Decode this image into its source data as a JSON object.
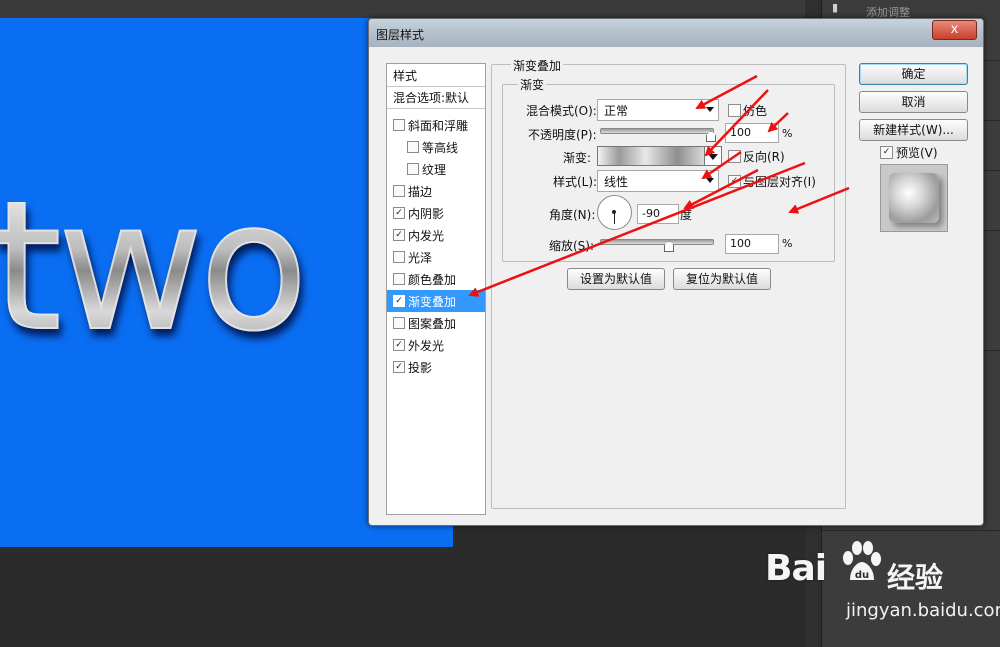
{
  "canvas": {
    "text": "two",
    "background_color": "#0a6ef2"
  },
  "right_panel": {
    "label": "添加调整"
  },
  "dialog": {
    "title": "图层样式",
    "close_label": "x",
    "style_list": {
      "header": "样式",
      "blend_options": "混合选项:默认",
      "items": [
        {
          "label": "斜面和浮雕",
          "checked": false,
          "indent": false
        },
        {
          "label": "等高线",
          "checked": false,
          "indent": true
        },
        {
          "label": "纹理",
          "checked": false,
          "indent": true
        },
        {
          "label": "描边",
          "checked": false,
          "indent": false
        },
        {
          "label": "内阴影",
          "checked": true,
          "indent": false
        },
        {
          "label": "内发光",
          "checked": true,
          "indent": false
        },
        {
          "label": "光泽",
          "checked": false,
          "indent": false
        },
        {
          "label": "颜色叠加",
          "checked": false,
          "indent": false
        },
        {
          "label": "渐变叠加",
          "checked": true,
          "indent": false,
          "selected": true
        },
        {
          "label": "图案叠加",
          "checked": false,
          "indent": false
        },
        {
          "label": "外发光",
          "checked": true,
          "indent": false
        },
        {
          "label": "投影",
          "checked": true,
          "indent": false
        }
      ]
    },
    "panel": {
      "section_title": "渐变叠加",
      "subsection_title": "渐变",
      "blend_mode_label": "混合模式(O):",
      "blend_mode_value": "正常",
      "dither_label": "仿色",
      "dither_checked": false,
      "opacity_label": "不透明度(P):",
      "opacity_value": "100",
      "percent": "%",
      "gradient_label": "渐变:",
      "reverse_label": "反向(R)",
      "reverse_checked": false,
      "style_label": "样式(L):",
      "style_value": "线性",
      "align_label": "与图层对齐(I)",
      "align_checked": true,
      "angle_label": "角度(N):",
      "angle_value": "-90",
      "angle_unit": "度",
      "scale_label": "缩放(S):",
      "scale_value": "100",
      "make_default": "设置为默认值",
      "reset_default": "复位为默认值"
    },
    "buttons": {
      "ok": "确定",
      "cancel": "取消",
      "new_style": "新建样式(W)...",
      "preview_label": "预览(V)",
      "preview_checked": true
    }
  },
  "watermark": {
    "logo_text": "Bai",
    "logo_suffix": "经验",
    "url": "jingyan.baidu.com"
  },
  "colors": {
    "arrow": "#ee1111",
    "selection": "#3399ff",
    "canvas_blue": "#0a6ef2"
  },
  "icons": [
    "close-icon",
    "checkbox-icon",
    "dropdown-arrow-icon",
    "angle-dial-icon",
    "paw-icon"
  ]
}
